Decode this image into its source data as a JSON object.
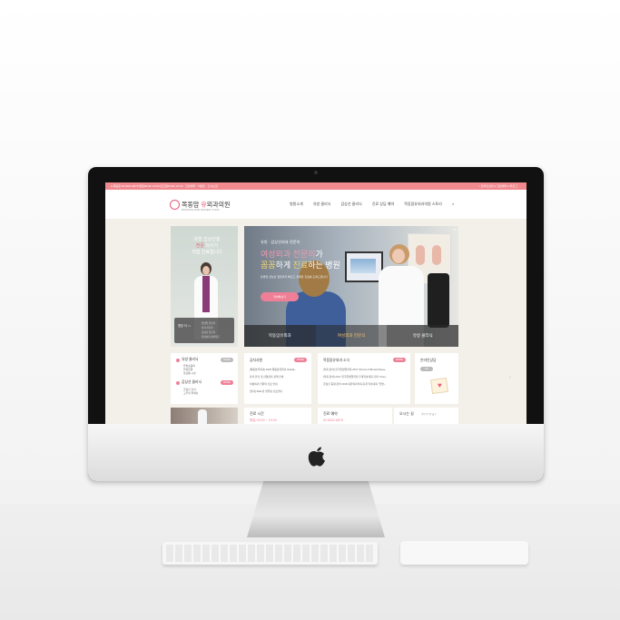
{
  "topbar": {
    "left": "● 목동점 02-6341-6875 평일09:00~19:00 토요일09:00~14:00 · 진료예약 · 이벤트 · 오시는길",
    "right": "○ 온라인상담 ● 진료예약 ● 블로그"
  },
  "header": {
    "logo_main": "목동맘",
    "logo_accent": "유",
    "logo_rest": "외과의원",
    "logo_sub": "MOKDONG MOM SURGERY CLINIC",
    "menu": [
      "병원소개",
      "유방 클리닉",
      "갑상선 클리닉",
      "진료 상담 예약",
      "목동맘유외과의원 스토리"
    ],
    "search_icon": "search-icon"
  },
  "left_promo": {
    "line1": "유방 갑상선을",
    "line2_pink": "전문",
    "line2": "의사가",
    "line3": "직접 진료합니다",
    "name": "원장 이 ○○",
    "lines": [
      "유방암 전문의",
      "외과 전문의",
      "갑상선 전문의",
      "유방외과 세부전문"
    ]
  },
  "banner": {
    "kicker": "유방 · 갑상선외과 전문의",
    "line1_pink": "여성외과 전문의",
    "line1": "가",
    "line2_yellow": "꼼꼼",
    "line2a": "하게 ",
    "line2_yellow2": "진료",
    "line2b": "하는 병원",
    "sub": "유방암 갑상선 질환까지 빠르고 정확한 진료를 도와드립니다.",
    "button": "자세히보기",
    "close": "×",
    "tabs": [
      "목동맘유외과",
      "여성외과 전문의",
      "유방 클리닉"
    ]
  },
  "cards": {
    "clinic": {
      "title1": "유방 클리닉",
      "items1": [
        "유방초음파",
        "유방촬영",
        "맘모톰 시술"
      ],
      "title2": "갑상선 클리닉",
      "items2": [
        "갑상선 검사",
        "고주파 절제술"
      ],
      "more": "MORE"
    },
    "notice": {
      "title": "공지사항",
      "more": "MORE",
      "items": [
        "[목동맘유외과] 2018 목동맘유외과 Global~",
        "환자 안전 및 감염관리 정책 안내",
        "여성외과 전문의 진료 안내",
        "[안내] 2021년 설연휴 진료안내"
      ]
    },
    "news": {
      "title": "목동맘유외과 소식",
      "more": "MORE",
      "items": [
        "[학회 참석] 한국유방암학회 2017 School of Breast Disea~",
        "[학회 참석] 2017 한국유방암학회 추계학술대회 강의 \"Over~",
        "갑상선 중재 참석 2018 대한외과학회 춘계 학술대회 \"유방~"
      ]
    },
    "online": {
      "title": "온라인상담",
      "more": "GO"
    }
  },
  "bottom": {
    "hours_title": "진료 시간",
    "hours_sub": "평일 09:00 ~ 19:00",
    "reserve_title": "진료 예약",
    "phone": "02.6341.6875",
    "directions_title": "오시는 길",
    "directions_sub": "목동역 7번 출구"
  },
  "colors": {
    "accent": "#ef7f97",
    "topbar": "#f08a8f"
  }
}
